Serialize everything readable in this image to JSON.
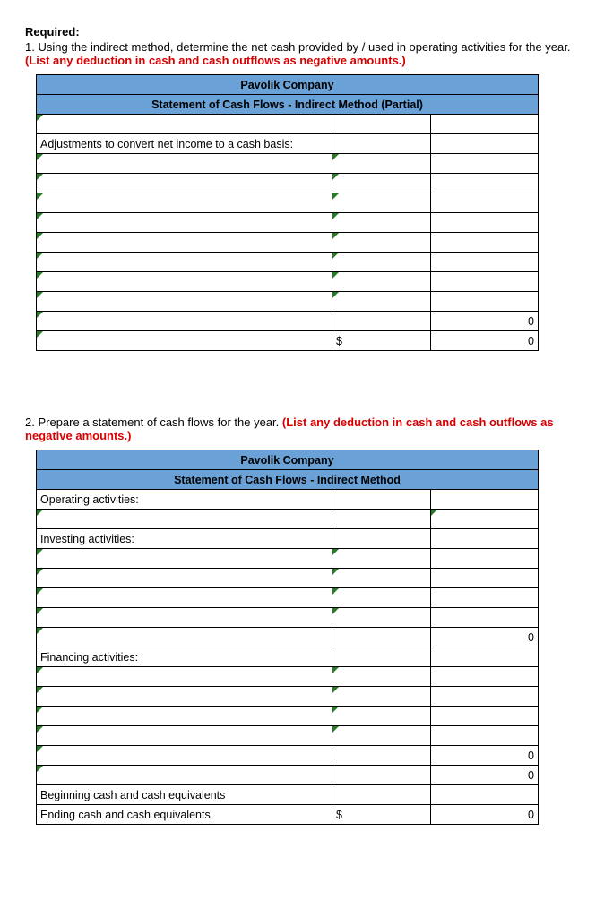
{
  "required_label": "Required:",
  "q1": {
    "num": "1.",
    "text_a": "Using the indirect method, determine the net cash provided by / used in operating activities for the year. ",
    "text_red": "(List any deduction in cash and cash outflows as negative amounts.)"
  },
  "q2": {
    "num": "2.",
    "text_a": "Prepare a statement of cash flows for the year. ",
    "text_red": "(List any deduction in cash and cash outflows as negative amounts.)"
  },
  "table1": {
    "company": "Pavolik Company",
    "title": "Statement of Cash Flows - Indirect Method (Partial)",
    "adjustments_label": "Adjustments to convert net income to a cash basis:",
    "totals": {
      "sub": "0",
      "currency": "$",
      "grand": "0"
    }
  },
  "table2": {
    "company": "Pavolik Company",
    "title": "Statement of Cash Flows - Indirect Method",
    "operating_label": "Operating activities:",
    "investing_label": "Investing activities:",
    "financing_label": "Financing activities:",
    "beginning_label": "Beginning cash and cash equivalents",
    "ending_label": "Ending cash and cash equivalents",
    "totals": {
      "investing_total": "0",
      "financing_sub": "0",
      "financing_total": "0",
      "currency": "$",
      "ending_total": "0"
    }
  }
}
